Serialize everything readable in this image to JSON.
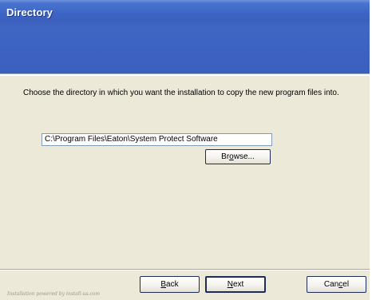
{
  "window": {
    "title": "Directory"
  },
  "content": {
    "instruction": "Choose the directory in which you want the installation to copy the new program files into.",
    "path_value": "C:\\Program Files\\Eaton\\System Protect Software"
  },
  "buttons": {
    "browse": {
      "pre": "Br",
      "accel": "o",
      "post": "wse..."
    },
    "back": {
      "pre": "",
      "accel": "B",
      "post": "ack"
    },
    "next": {
      "pre": "",
      "accel": "N",
      "post": "ext"
    },
    "cancel": {
      "pre": "Can",
      "accel": "c",
      "post": "el"
    }
  },
  "footer": {
    "powered_by": "Installation powered by install-us.com"
  },
  "colors": {
    "title_bar": "#3e66c6",
    "banner": "#3b61bf",
    "dialog_face": "#ece9d8",
    "input_border": "#7f9db9",
    "button_border": "#1f2c5a"
  }
}
